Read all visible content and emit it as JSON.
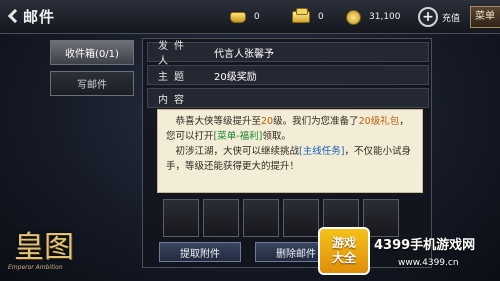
{
  "header": {
    "title": "邮件",
    "resources": [
      {
        "icon": "gold-ingot-icon",
        "value": "0"
      },
      {
        "icon": "silver-tael-icon",
        "value": "0"
      },
      {
        "icon": "copper-coin-icon",
        "value": "31,100"
      }
    ],
    "recharge_label": "充值",
    "menu_label": "菜单"
  },
  "tabs": {
    "inbox_label": "收件箱(0/1)",
    "write_label": "写邮件"
  },
  "mail": {
    "sender_label": "发件人",
    "sender_value": "代言人张馨予",
    "subject_label": "主题",
    "subject_value": "20级奖励",
    "content_label": "内容",
    "body": {
      "p1_a": "恭喜大侠等级提升至",
      "p1_level": "20",
      "p1_b": "级。我们为您准备了",
      "p1_gift": "20级礼包",
      "p1_c": "，您可以打开",
      "p1_link": "[菜单-福利]",
      "p1_d": "领取。",
      "p2_a": "初涉江湖，大侠可以继续挑战",
      "p2_link": "[主线任务]",
      "p2_b": "，不仅能小试身手，等级还能获得更大的提升！"
    },
    "claim_button": "提取附件",
    "delete_button": "删除邮件"
  },
  "logo": {
    "mark": "皇图",
    "sub": "Emperor Ambition"
  },
  "watermark": {
    "badge_line1": "游戏",
    "badge_line2": "大全",
    "text": "4399手机游戏网",
    "url": "www.4399.cn"
  },
  "colors": {
    "highlight_orange": "#c85a00",
    "highlight_green": "#1a8a36",
    "highlight_blue": "#1b5fb8",
    "parchment": "#f3ecd6"
  }
}
